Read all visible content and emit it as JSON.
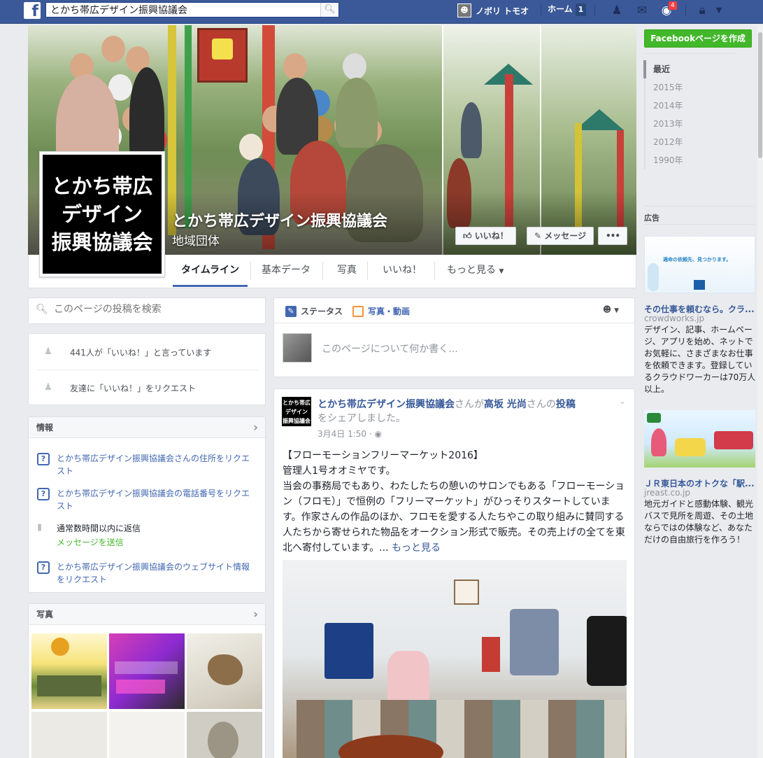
{
  "topbar": {
    "logo": "f",
    "search_value": "とかち帯広デザイン振興協議会",
    "user_name": "ノボリ トモオ",
    "home_label": "ホーム",
    "home_count": "1",
    "notif_count": "4"
  },
  "cover": {
    "page_name": "とかち帯広デザイン振興協議会",
    "category": "地域団体",
    "profile_lines": [
      "とかち帯広",
      "デザイン",
      "振興協議会"
    ],
    "like_btn": "いいね！",
    "message_btn": "メッセージ",
    "more_btn": "•••"
  },
  "tabs": [
    "タイムライン",
    "基本データ",
    "写真",
    "いいね！",
    "もっと見る"
  ],
  "left": {
    "search_placeholder": "このページの投稿を検索",
    "likes_count": "441人が「いいね！」と言っています",
    "invite": "友達に「いいね！」をリクエスト",
    "info_title": "情報",
    "info_items": [
      "とかち帯広デザイン振興協議会さんの住所をリクエスト",
      "とかち帯広デザイン振興協議会の電話番号をリクエスト",
      "とかち帯広デザイン振興協議会のウェブサイト情報をリクエスト"
    ],
    "response_time": "通常数時間以内に返信",
    "send_message": "メッセージを送信",
    "photos_title": "写真"
  },
  "composer": {
    "status_tab": "ステータス",
    "photo_tab": "写真・動画",
    "placeholder": "このページについて何か書く..."
  },
  "post": {
    "author": "とかち帯広デザイン振興協議会",
    "shared_mid": "さんが",
    "shared_person": "高坂 光尚",
    "shared_mid2": "さんの",
    "shared_link": "投稿",
    "shared_end": "をシェアしました。",
    "time": "3月4日 1:50",
    "title": "【フローモーションフリーマーケット2016】",
    "line1": "管理人1号オオミヤです。",
    "body": "当会の事務局でもあり、わたしたちの憩いのサロンでもある「フローモーション（フロモ）」で恒例の「フリーマーケット」がひっそりスタートしています。作家さんの作品のほか、フロモを愛する人たちやこの取り組みに賛同する人たちから寄せられた物品をオークション形式で販売。その売上げの全てを東北へ寄付しています。...",
    "see_more": "もっと見る"
  },
  "right": {
    "create_page": "Facebookページを作成",
    "years": [
      "最近",
      "2015年",
      "2014年",
      "2013年",
      "2012年",
      "1990年"
    ],
    "ads_title": "広告",
    "ad1": {
      "banner": "適命の依頼先、見つかります。",
      "title": "その仕事を頼むなら。クラ...",
      "domain": "crowdworks.jp",
      "text": "デザイン、記事、ホームページ、アプリを始め、ネットでお気軽に、さまざまなお仕事を依頼できます。登録しているクラウドワーカーは70万人以上。"
    },
    "ad2": {
      "title": "ＪＲ東日本のオトクな「駅...",
      "domain": "jreast.co.jp",
      "text": "地元ガイドと感動体験、観光バスで見所を周遊、その土地ならではの体験など、あなただけの自由旅行を作ろう！"
    }
  }
}
